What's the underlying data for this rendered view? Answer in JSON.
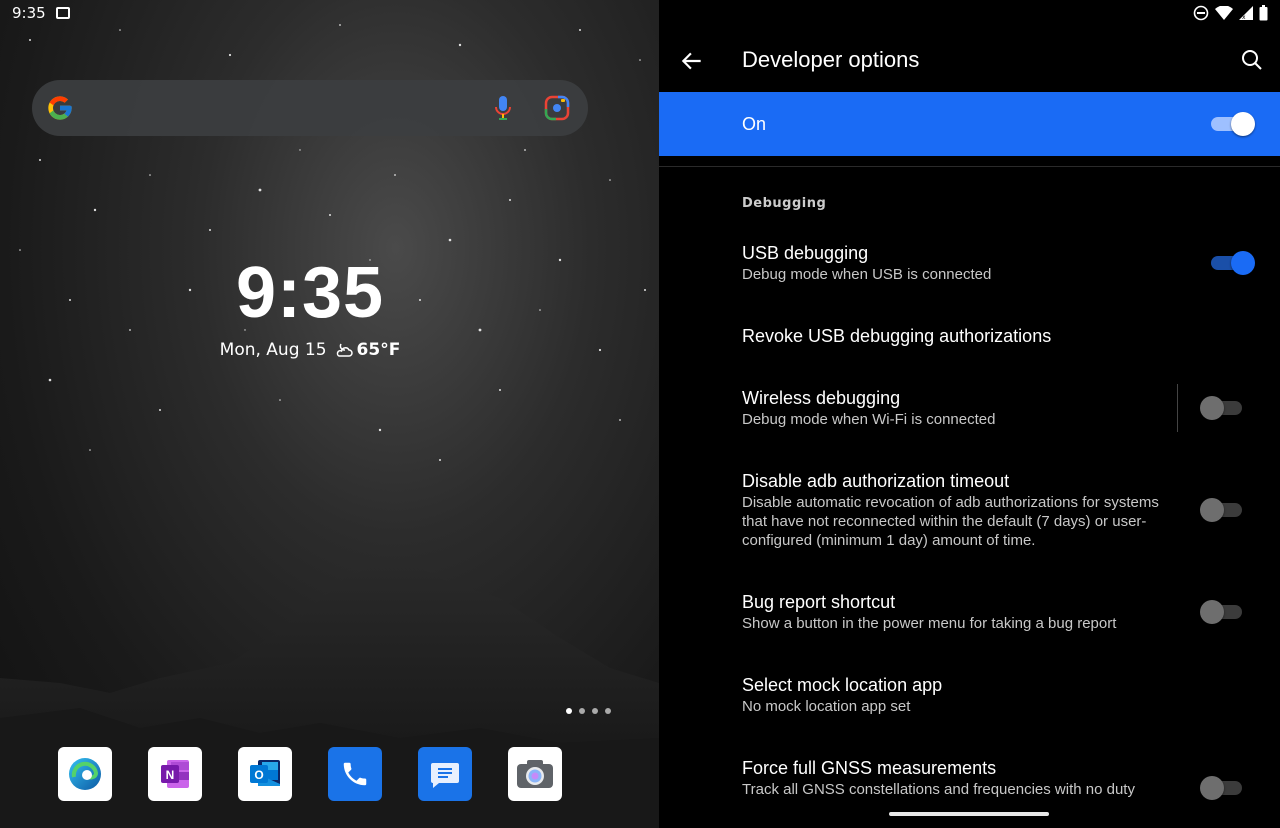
{
  "status": {
    "time": "9:35"
  },
  "home": {
    "clock": "9:35",
    "date": "Mon, Aug 15",
    "temperature": "65°F",
    "weather_icon": "partly-cloudy-night-icon",
    "dock_apps": [
      "Microsoft Edge",
      "OneNote",
      "Outlook",
      "Phone",
      "Messages",
      "Camera"
    ],
    "page_count": 4,
    "active_page": 1
  },
  "settings": {
    "title": "Developer options",
    "master_switch": {
      "label": "On",
      "state": true
    },
    "section_debugging": "Debugging",
    "prefs": [
      {
        "title": "USB debugging",
        "summary": "Debug mode when USB is connected",
        "switch": true
      },
      {
        "title": "Revoke USB debugging authorizations",
        "summary": ""
      },
      {
        "title": "Wireless debugging",
        "summary": "Debug mode when Wi-Fi is connected",
        "switch": false
      },
      {
        "title": "Disable adb authorization timeout",
        "summary": "Disable automatic revocation of adb authorizations for systems that have not reconnected within the default (7 days) or user-configured (minimum 1 day) amount of time.",
        "switch": false
      },
      {
        "title": "Bug report shortcut",
        "summary": "Show a button in the power menu for taking a bug report",
        "switch": false
      },
      {
        "title": "Select mock location app",
        "summary": "No mock location app set"
      },
      {
        "title": "Force full GNSS measurements",
        "summary": "Track all GNSS constellations and frequencies with no duty",
        "switch": false
      }
    ]
  },
  "colors": {
    "accent": "#1a6bf5",
    "background": "#000000"
  }
}
